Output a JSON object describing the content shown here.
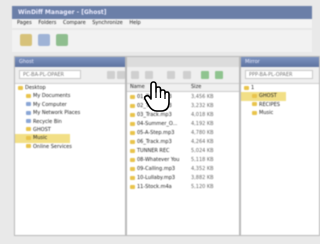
{
  "window": {
    "title": "WinDiff Manager - [Ghost]"
  },
  "menu": [
    "Pages",
    "Folders",
    "Compare",
    "Synchronize",
    "Help"
  ],
  "toolbar": {
    "icons": [
      "open-icon",
      "save-icon",
      "refresh-icon"
    ]
  },
  "left_panel": {
    "title": "Ghost",
    "address_placeholder": "PC-BA-PL-OPAER",
    "tree": [
      {
        "label": "Desktop",
        "indent": 0,
        "icon": "folder-icon"
      },
      {
        "label": "My Documents",
        "indent": 1,
        "icon": "folder-icon"
      },
      {
        "label": "My Computer",
        "indent": 1,
        "icon": "computer-icon"
      },
      {
        "label": "My Network Places",
        "indent": 1,
        "icon": "network-icon"
      },
      {
        "label": "Recycle Bin",
        "indent": 1,
        "icon": "recycle-icon"
      },
      {
        "label": "GHOST",
        "indent": 1,
        "icon": "folder-icon"
      },
      {
        "label": "Music",
        "indent": 1,
        "icon": "folder-icon",
        "selected": true
      },
      {
        "label": "Online Services",
        "indent": 1,
        "icon": "folder-icon"
      }
    ]
  },
  "file_list": {
    "columns": [
      "Name",
      "Size"
    ],
    "rows": [
      {
        "name": "01_Track.mp3",
        "size": "3,456 KB"
      },
      {
        "name": "02_Track.mp3",
        "size": "3,232 KB"
      },
      {
        "name": "03_Track.mp3",
        "size": "4,018 KB"
      },
      {
        "name": "04-Summer_O...",
        "size": "4,192 KB"
      },
      {
        "name": "05-A-Step.mp3",
        "size": "4,780 KB"
      },
      {
        "name": "06_Track.mp3",
        "size": "4,264 KB"
      },
      {
        "name": "TUNNER REC",
        "size": "5,024 KB"
      },
      {
        "name": "08-Whatever You",
        "size": "5,118 KB"
      },
      {
        "name": "09-Calling.mp3",
        "size": "4,352 KB"
      },
      {
        "name": "10-Lullaby.mp3",
        "size": "3,882 KB"
      },
      {
        "name": "11-Stock.m4a",
        "size": "5,120 KB"
      }
    ]
  },
  "right_panel": {
    "title": "Mirror",
    "address_placeholder": "PPP-BA-PL-OPAER",
    "tree": [
      {
        "label": "1",
        "indent": 0,
        "icon": "folder-icon"
      },
      {
        "label": "GHOST",
        "indent": 1,
        "icon": "folder-icon",
        "selected": true
      },
      {
        "label": "RECIPES",
        "indent": 1,
        "icon": "folder-icon"
      },
      {
        "label": "Music",
        "indent": 1,
        "icon": "folder-icon"
      }
    ]
  },
  "colors": {
    "titlebar": "#6b7fa8",
    "folder": "#e9c44c",
    "selection": "#f2df86"
  }
}
